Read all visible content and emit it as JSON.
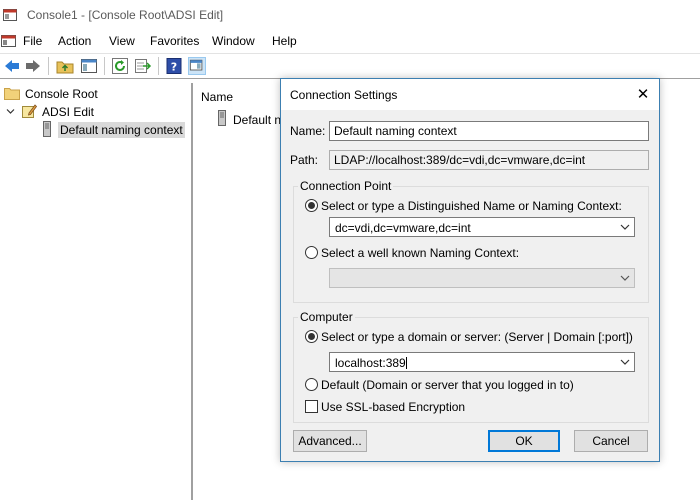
{
  "window": {
    "title": "Console1 - [Console Root\\ADSI Edit]"
  },
  "menubar": {
    "items": [
      "File",
      "Action",
      "View",
      "Favorites",
      "Window",
      "Help"
    ]
  },
  "toolbar": {
    "icons": [
      "back-arrow-icon",
      "forward-arrow-icon",
      "up-folder-icon",
      "show-hide-tree-icon",
      "refresh-icon",
      "export-list-icon",
      "help-icon",
      "show-hide-action-pane-icon"
    ]
  },
  "tree": {
    "root": "Console Root",
    "adsi": "ADSI Edit",
    "context": "Default naming context"
  },
  "result_pane": {
    "column_header": "Name",
    "row": "Default nam"
  },
  "dialog": {
    "title": "Connection Settings",
    "close_glyph": "✕",
    "name_label": "Name:",
    "name_value": "Default naming context",
    "path_label": "Path:",
    "path_value": "LDAP://localhost:389/dc=vdi,dc=vmware,dc=int",
    "connection_point": {
      "title": "Connection Point",
      "option1_label": "Select or type a Distinguished Name or Naming Context:",
      "option1_value": "dc=vdi,dc=vmware,dc=int",
      "option1_selected": true,
      "option2_label": "Select a well known Naming Context:",
      "option2_value": ""
    },
    "computer": {
      "title": "Computer",
      "option1_label": "Select or type a domain or server: (Server | Domain [:port])",
      "option1_value": "localhost:389",
      "option1_selected": true,
      "option2_label": "Default (Domain or server that you logged in to)",
      "ssl_label": "Use SSL-based Encryption",
      "ssl_checked": false
    },
    "buttons": {
      "advanced": "Advanced...",
      "ok": "OK",
      "cancel": "Cancel"
    }
  },
  "colors": {
    "accent": "#0078d7",
    "dialog_border": "#3c7fb1",
    "dialog_bg": "#f0f0f0"
  }
}
